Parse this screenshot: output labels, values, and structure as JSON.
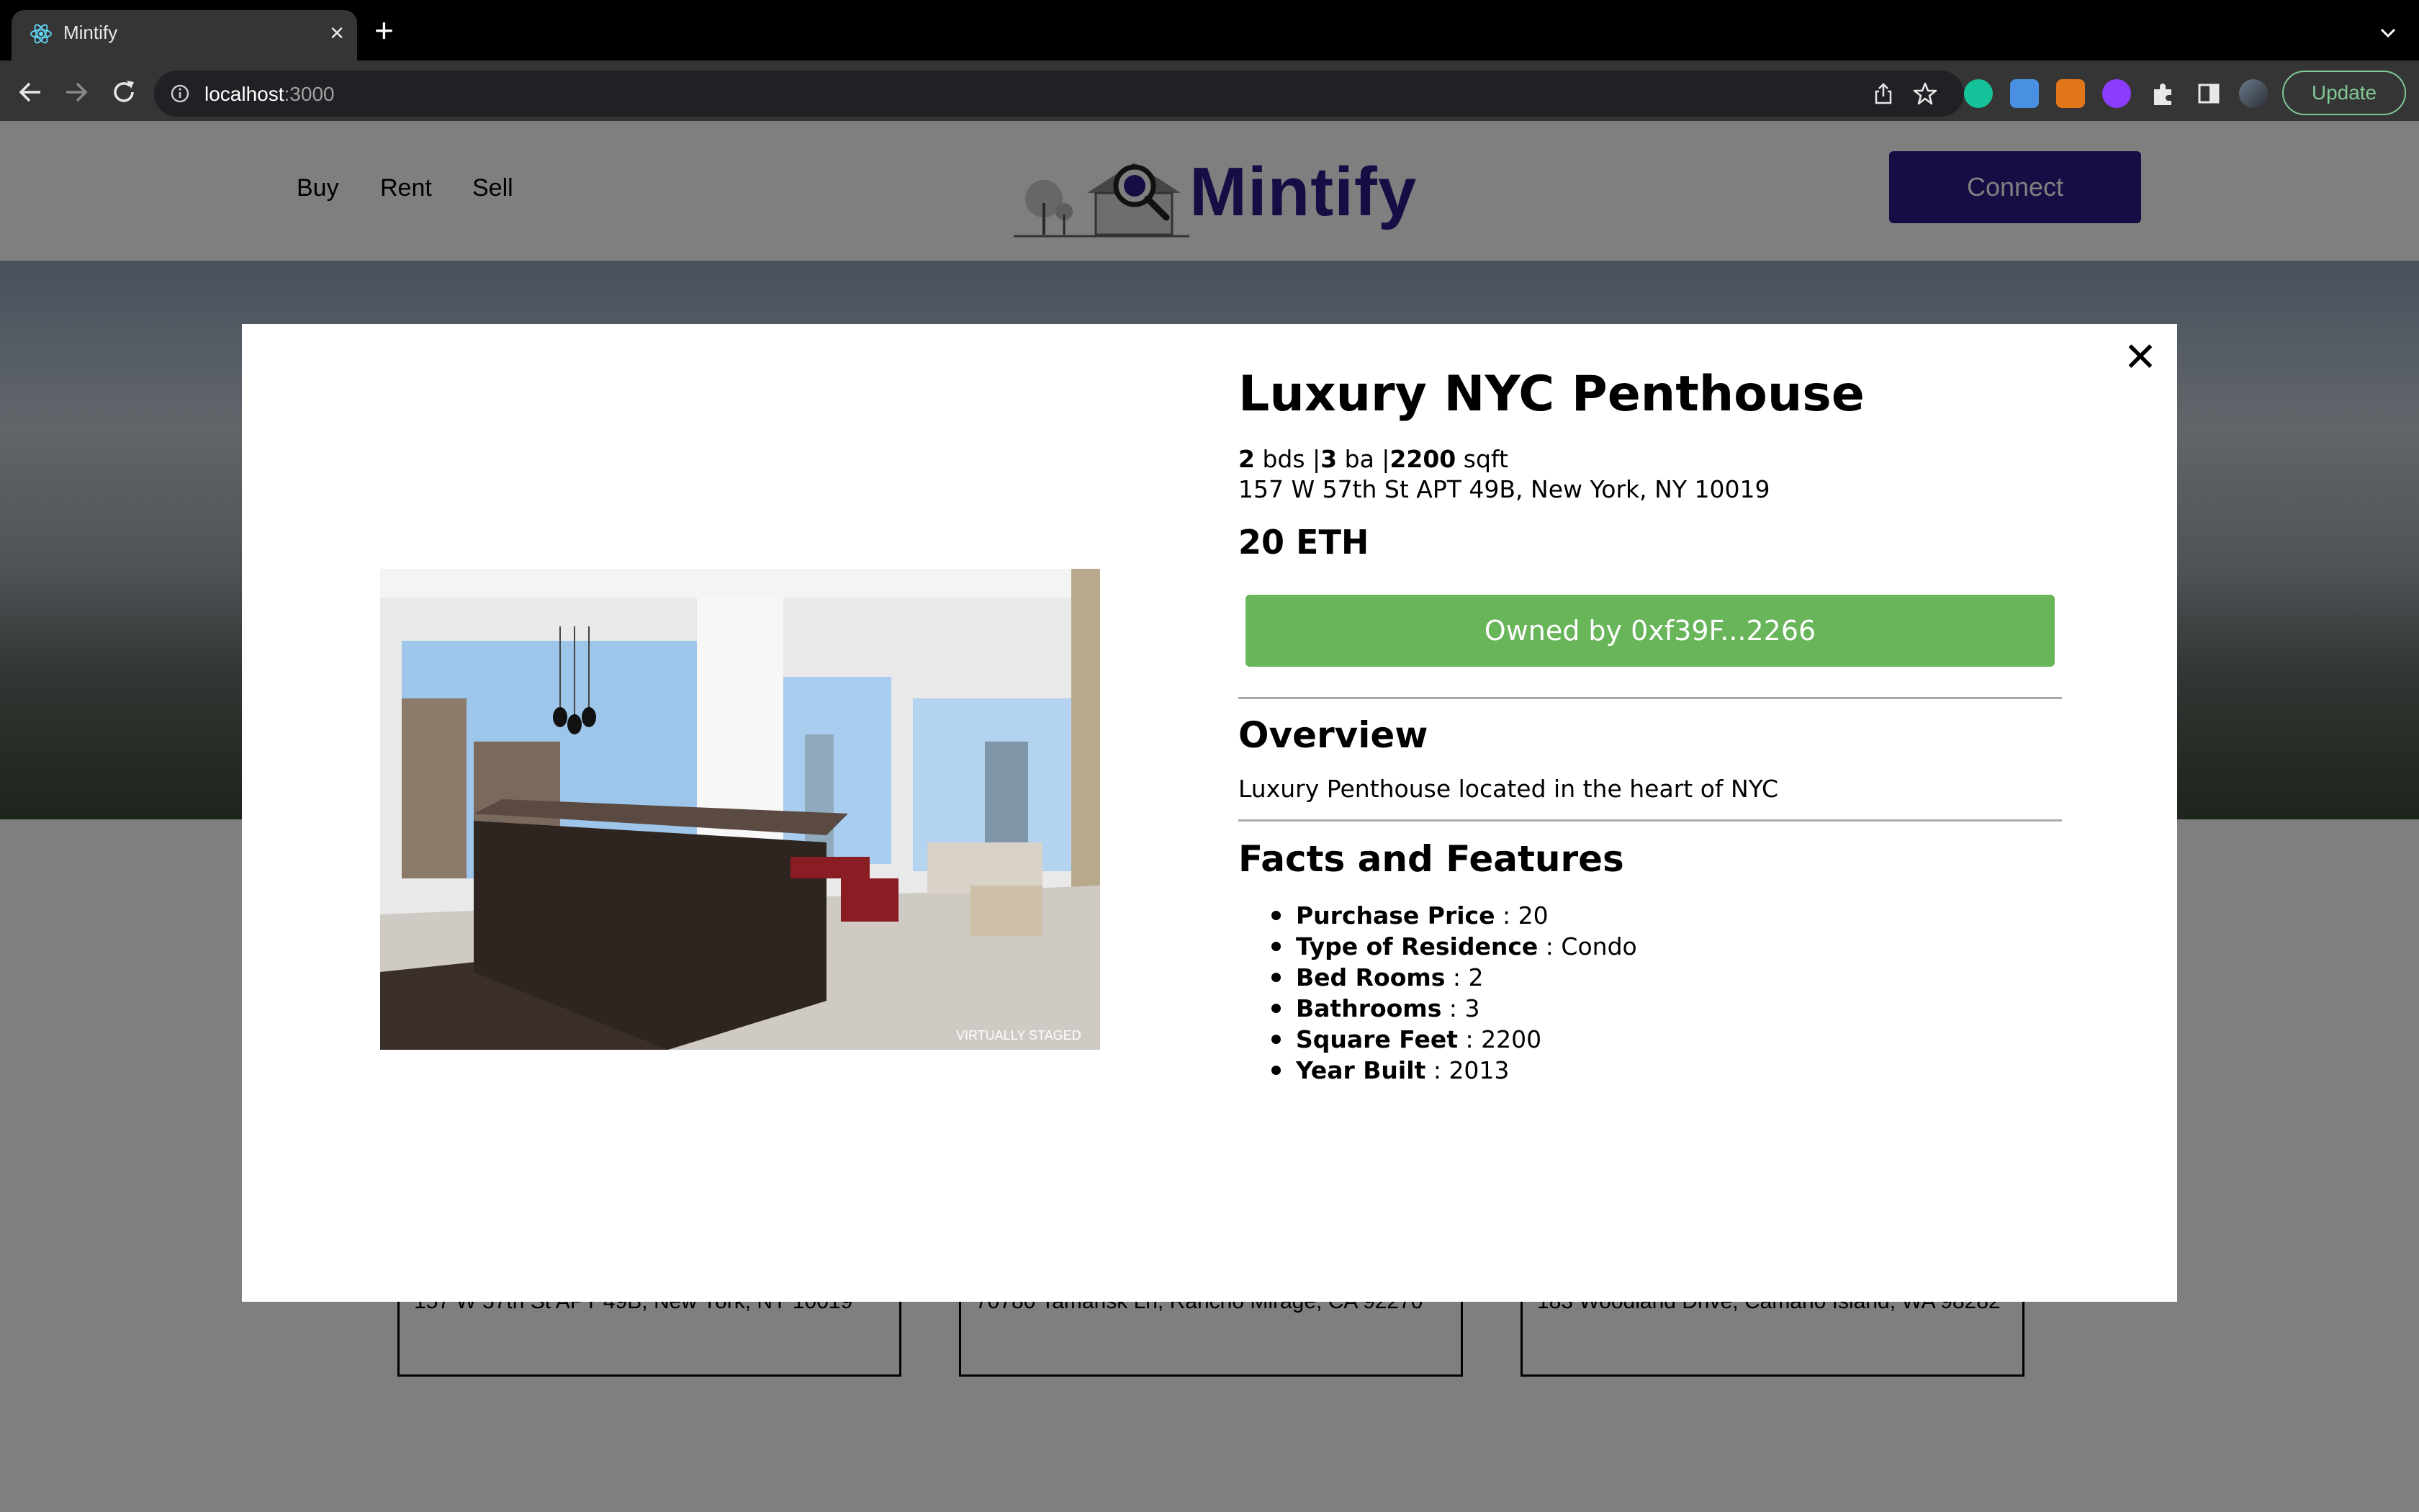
{
  "browser": {
    "tab_title": "Mintify",
    "url_host": "localhost",
    "url_port": ":3000",
    "update_label": "Update",
    "icons": [
      "react-favicon",
      "close-icon",
      "plus-icon",
      "chevron-down-icon",
      "back-icon",
      "forward-icon",
      "reload-icon",
      "info-icon",
      "share-icon",
      "star-icon",
      "grammarly-icon",
      "dropbox-icon",
      "metamask-icon",
      "extension-icon",
      "puzzle-icon",
      "sidepanel-icon",
      "avatar"
    ]
  },
  "site": {
    "nav": [
      "Buy",
      "Rent",
      "Sell"
    ],
    "brand": "Mintify",
    "brand_color": "#2d1b8a",
    "connect_label": "Connect",
    "cards": [
      {
        "address": "157 W 57th St APT 49B, New York, NY 10019"
      },
      {
        "address": "70780 Tamarisk Ln, Rancho Mirage, CA 92270"
      },
      {
        "address": "183 Woodland Drive, Camano Island, WA 98282"
      }
    ]
  },
  "modal": {
    "title": "Luxury NYC Penthouse",
    "beds": "2",
    "beds_unit": "bds",
    "baths": "3",
    "baths_unit": "ba",
    "sqft": "2200",
    "sqft_unit": "sqft",
    "address": "157 W 57th St APT 49B, New York, NY 10019",
    "price": "20 ETH",
    "owner_label": "Owned by 0xf39F...2266",
    "owner_color": "#68b55a",
    "overview_heading": "Overview",
    "overview_text": "Luxury Penthouse located in the heart of NYC",
    "facts_heading": "Facts and Features",
    "facts": [
      {
        "label": "Purchase Price",
        "value": "20"
      },
      {
        "label": "Type of Residence",
        "value": "Condo"
      },
      {
        "label": "Bed Rooms",
        "value": "2"
      },
      {
        "label": "Bathrooms",
        "value": "3"
      },
      {
        "label": "Square Feet",
        "value": "2200"
      },
      {
        "label": "Year Built",
        "value": "2013"
      }
    ],
    "image_watermark": "VIRTUALLY STAGED",
    "close_icon": "close-icon"
  }
}
